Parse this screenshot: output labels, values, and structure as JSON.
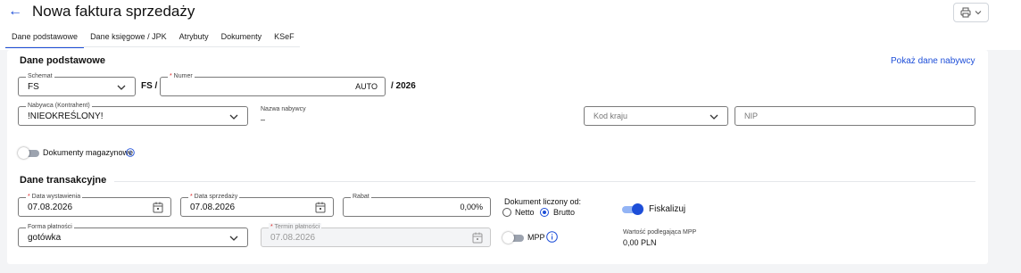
{
  "header": {
    "title": "Nowa faktura sprzedaży",
    "back_icon": "arrow-left-icon",
    "print_icon": "printer-icon"
  },
  "tabs": [
    {
      "label": "Dane podstawowe",
      "active": true
    },
    {
      "label": "Dane księgowe / JPK",
      "active": false
    },
    {
      "label": "Atrybuty",
      "active": false
    },
    {
      "label": "Dokumenty",
      "active": false
    },
    {
      "label": "KSeF",
      "active": false
    }
  ],
  "basic": {
    "section_title": "Dane podstawowe",
    "show_buyer_link": "Pokaż dane nabywcy",
    "schema": {
      "label": "Schemat",
      "value": "FS"
    },
    "schema_suffix": "FS /",
    "number": {
      "label": "Numer",
      "value": "AUTO"
    },
    "year_suffix": "/ 2026",
    "buyer": {
      "label": "Nabywca (Kontrahent)",
      "value": "!NIEOKREŚLONY!"
    },
    "buyer_name": {
      "label": "Nazwa nabywcy",
      "value": "–"
    },
    "country_code": {
      "placeholder": "Kod kraju"
    },
    "nip": {
      "placeholder": "NIP"
    },
    "warehouse_docs": {
      "label": "Dokumenty magazynowe",
      "enabled": false
    }
  },
  "transaction": {
    "section_title": "Dane transakcyjne",
    "issue_date": {
      "label": "Data wystawienia",
      "value": "07.08.2026"
    },
    "sale_date": {
      "label": "Data sprzedaży",
      "value": "07.08.2026"
    },
    "discount": {
      "label": "Rabat",
      "value": "0,00%"
    },
    "calculated_from": {
      "label": "Dokument liczony od:",
      "options": [
        "Netto",
        "Brutto"
      ],
      "selected": "Brutto"
    },
    "fiscalize": {
      "label": "Fiskalizuj",
      "enabled": true
    },
    "payment_form": {
      "label": "Forma płatności",
      "value": "gotówka"
    },
    "payment_due": {
      "label": "Termin płatności",
      "value": "07.08.2026"
    },
    "mpp": {
      "label": "MPP",
      "enabled": false
    },
    "mpp_value": {
      "label": "Wartość podlegająca MPP",
      "value": "0,00 PLN"
    }
  },
  "colors": {
    "accent": "#1d4ed8",
    "required": "#dc2626",
    "background": "#f3f4f6"
  }
}
